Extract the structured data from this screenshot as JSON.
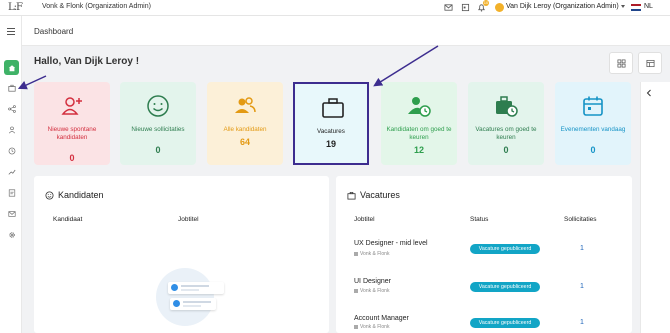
{
  "topbar": {
    "logo": "L:F",
    "org": "Vonk & Flonk (Organization Admin)",
    "notif_count": "10",
    "user": "Van Dijk Leroy (Organization Admin)",
    "lang": "NL"
  },
  "page": {
    "breadcrumb": "Dashboard",
    "greeting": "Hallo, Van Dijk Leroy !"
  },
  "cards": [
    {
      "label": "Nieuwe spontane kandidaten",
      "value": "0",
      "bg": "#fbe3e5",
      "color": "#d32f3f"
    },
    {
      "label": "Nieuwe sollicitaties",
      "value": "0",
      "bg": "#e3f4ec",
      "color": "#2e7d4f"
    },
    {
      "label": "Alle kandidaten",
      "value": "64",
      "bg": "#fcf0d8",
      "color": "#e39a14"
    },
    {
      "label": "Vacatures",
      "value": "19",
      "bg": "#e8f8fb",
      "color": "#222"
    },
    {
      "label": "Kandidaten om goed te keuren",
      "value": "12",
      "bg": "#e3f6e9",
      "color": "#2e9e4d"
    },
    {
      "label": "Vacatures om goed te keuren",
      "value": "0",
      "bg": "#e3f4ec",
      "color": "#2e7d4f"
    },
    {
      "label": "Evenementen vandaag",
      "value": "0",
      "bg": "#e2f4fb",
      "color": "#1593c6"
    }
  ],
  "kandidaten": {
    "title": "Kandidaten",
    "col1": "Kandidaat",
    "col2": "Jobtitel"
  },
  "vacatures": {
    "title": "Vacatures",
    "col1": "Jobtitel",
    "col2": "Status",
    "col3": "Sollicitaties",
    "rows": [
      {
        "title": "UX Designer - mid level",
        "company": "Vonk & Flonk",
        "status": "Vacature gepubliceerd",
        "count": "1"
      },
      {
        "title": "UI Designer",
        "company": "Vonk & Flonk",
        "status": "Vacature gepubliceerd",
        "count": "1"
      },
      {
        "title": "Account Manager",
        "company": "Vonk & Flonk",
        "status": "Vacature gepubliceerd",
        "count": "1"
      }
    ]
  },
  "colors": {
    "accent": "#3fb267",
    "highlight": "#3d2d8f",
    "badge": "#12a5c6"
  }
}
